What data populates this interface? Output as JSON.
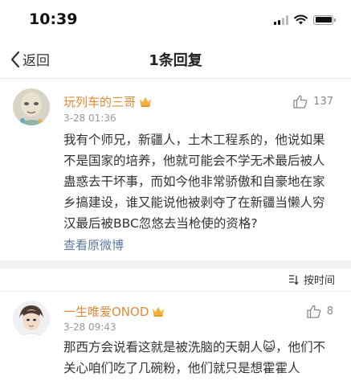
{
  "status_bar": {
    "time": "10:39"
  },
  "nav": {
    "back_label": "返回",
    "title": "1条回复"
  },
  "main_comment": {
    "username": "玩列车的三哥",
    "date": "3-28 01:36",
    "likes": "137",
    "text": "我有个师兄，新疆人，土木工程系的，他说如果不是国家的培养，他就可能会不学无术最后被人蛊惑去干坏事，而如今他非常骄傲和自豪地在家乡搞建设，谁又能说他被剥夺了在新疆当懒人穷汉最后被BBC忽悠去当枪使的资格?",
    "view_original": "查看原微博"
  },
  "sort": {
    "label": "按时间"
  },
  "reply": {
    "username": "一生唯爱ONOD",
    "date": "3-28 09:43",
    "likes": "8",
    "text": "那西方会说看这就是被洗脑的天朝人😺，他们不关心咱们吃了几碗粉，他们就只是想霍霍人"
  },
  "colors": {
    "username": "#e38a38",
    "link": "#5b7aa1",
    "meta": "#999999"
  }
}
